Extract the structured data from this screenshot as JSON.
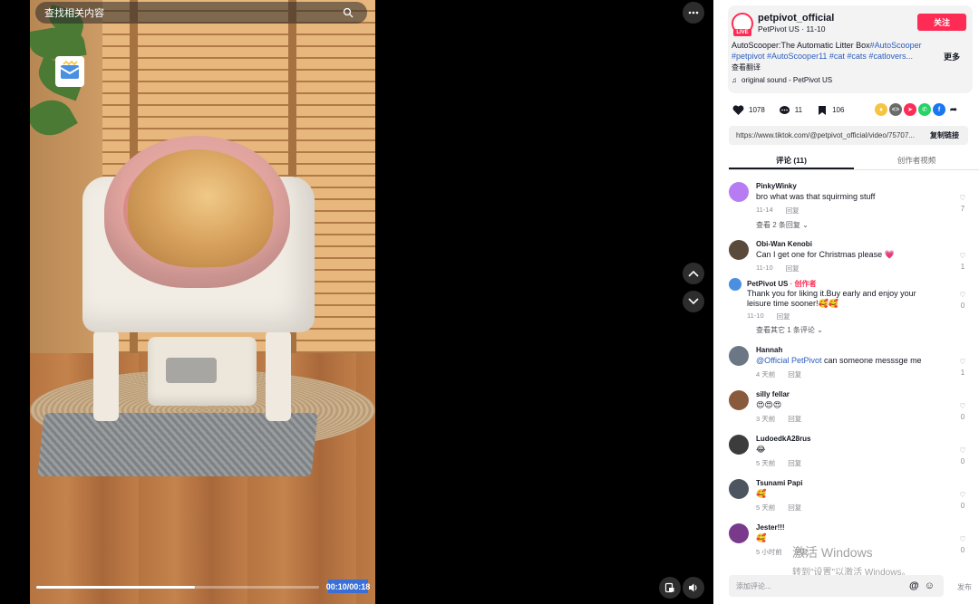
{
  "video": {
    "search_label": "查找相关内容",
    "time": "00:10/00:18",
    "progress": 0.56
  },
  "creator": {
    "username": "petpivot_official",
    "live_badge": "LIVE",
    "display_name": "PetPivot US",
    "date": "11-10",
    "follow_label": "关注",
    "desc_text": "AutoScooper:The Automatic Litter Box",
    "hashtags_line1": "#AutoScooper",
    "hashtags_line2": "#petpivot #AutoScooper11 #cat #cats #catlovers...",
    "more_label": "更多",
    "translate_label": "查看翻译",
    "sound_icon": "music-note-icon",
    "sound": "original sound - PetPivot US"
  },
  "stats": {
    "likes": "1078",
    "comments": "11",
    "saves": "106"
  },
  "share_colors": [
    "#f5c542",
    "#6b6b6b",
    "#fe2c55",
    "#25d366",
    "#1877f2"
  ],
  "link": {
    "url": "https://www.tiktok.com/@petpivot_official/video/75707...",
    "copy_label": "复制链接"
  },
  "tabs": {
    "comments_label": "评论 (11)",
    "creator_videos_label": "创作者视频"
  },
  "comments": [
    {
      "name": "PinkyWinky",
      "text": "bro what was that squirming stuff",
      "date": "11-14",
      "reply": "回复",
      "likes": "7",
      "replies_link": "查看 2 条回复",
      "avatar_color": "#b77cf2"
    },
    {
      "name": "Obi-Wan Kenobi",
      "text": "Can I get one for Christmas please 💗",
      "date": "11-10",
      "reply": "回复",
      "likes": "1",
      "avatar_color": "#5a4a3c"
    },
    {
      "name": "PetPivot US",
      "creator_tag": "· 创作者",
      "text": "Thank you for liking it.Buy early and enjoy your leisure time sooner!🥰🥰",
      "date": "11-10",
      "reply": "回复",
      "likes": "0",
      "replies_link": "查看其它 1 条评论",
      "avatar_color": "#4a8fe0"
    },
    {
      "name": "Hannah",
      "mention": "@Official PetPivot",
      "text": "can someone messsge me",
      "date": "4 天前",
      "reply": "回复",
      "likes": "1",
      "avatar_color": "#6b7785"
    },
    {
      "name": "silly fellar",
      "text": "😍😍😍",
      "date": "3 天前",
      "reply": "回复",
      "likes": "0",
      "avatar_color": "#8a5a3c"
    },
    {
      "name": "LudoedkA28rus",
      "text": "😂",
      "date": "5 天前",
      "reply": "回复",
      "likes": "0",
      "avatar_color": "#3c3c3c"
    },
    {
      "name": "Tsunami Papi",
      "text": "🥰",
      "date": "5 天前",
      "reply": "回复",
      "likes": "0",
      "avatar_color": "#4d5560"
    },
    {
      "name": "Jester!!!",
      "text": "🥰",
      "date": "5 小时前",
      "reply": "回复",
      "likes": "0",
      "avatar_color": "#7a3a8c"
    }
  ],
  "composer": {
    "placeholder": "添加评论...",
    "mention_icon": "@",
    "post_label": "发布"
  },
  "watermark": {
    "line1": "激活 Windows",
    "line2": "转到\"设置\"以激活 Windows。"
  }
}
